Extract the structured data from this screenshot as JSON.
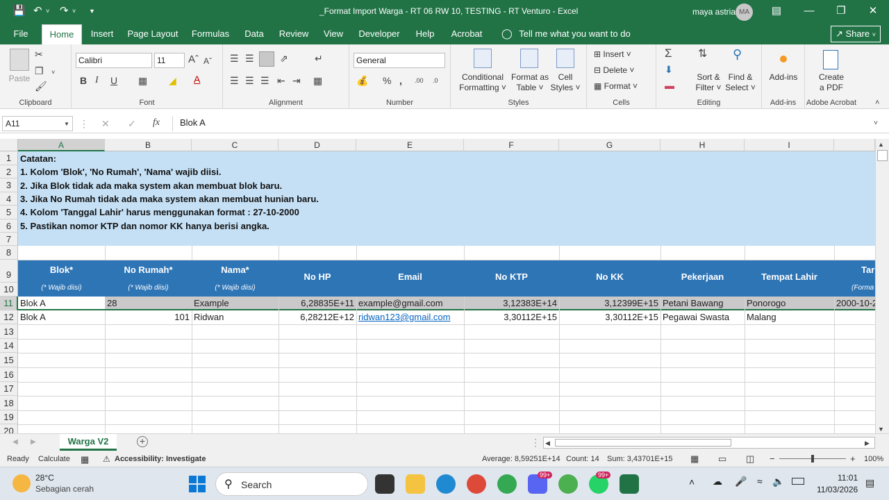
{
  "window": {
    "title": "_Format Import Warga - RT 06 RW 10, TESTING - RT Venturo  -  Excel",
    "user_name": "maya astria",
    "user_initials": "MA"
  },
  "ribbon_tabs": [
    "File",
    "Home",
    "Insert",
    "Page Layout",
    "Formulas",
    "Data",
    "Review",
    "View",
    "Developer",
    "Help",
    "Acrobat"
  ],
  "tell_me": "Tell me what you want to do",
  "share": "Share",
  "ribbon": {
    "clipboard": {
      "label": "Clipboard",
      "paste": "Paste"
    },
    "font": {
      "label": "Font",
      "name": "Calibri",
      "size": "11"
    },
    "alignment": {
      "label": "Alignment"
    },
    "number": {
      "label": "Number",
      "format": "General"
    },
    "styles": {
      "label": "Styles",
      "conditional": [
        "Conditional",
        "Formatting ˅"
      ],
      "format_table": [
        "Format as",
        "Table ˅"
      ],
      "cell_styles": [
        "Cell",
        "Styles ˅"
      ]
    },
    "cells": {
      "label": "Cells",
      "insert": "Insert",
      "delete": "Delete",
      "format": "Format"
    },
    "editing": {
      "label": "Editing",
      "sort": [
        "Sort &",
        "Filter ˅"
      ],
      "find": [
        "Find &",
        "Select ˅"
      ]
    },
    "addins": {
      "label": "Add-ins",
      "button": "Add-ins"
    },
    "acrobat": {
      "label": "Adobe Acrobat",
      "button": [
        "Create",
        "a PDF"
      ]
    }
  },
  "formula_bar": {
    "name_box": "A11",
    "formula": "Blok A",
    "fx": "fx"
  },
  "columns": [
    "A",
    "B",
    "C",
    "D",
    "E",
    "F",
    "G",
    "H",
    "I"
  ],
  "rows": [
    "1",
    "2",
    "3",
    "4",
    "5",
    "6",
    "7",
    "8",
    "9",
    "10",
    "11",
    "12",
    "13",
    "14",
    "15",
    "16",
    "17",
    "18",
    "19",
    "20"
  ],
  "notes": [
    "Catatan:",
    "1. Kolom 'Blok', 'No Rumah', 'Nama' wajib diisi.",
    "2. Jika Blok tidak ada maka system akan membuat blok baru.",
    "3. Jika No Rumah tidak ada maka system akan membuat hunian baru.",
    "4. Kolom 'Tanggal Lahir' harus menggunakan format : 27-10-2000",
    "5. Pastikan nomor KTP dan nomor KK hanya berisi angka."
  ],
  "table_headers": [
    "Blok*",
    "No Rumah*",
    "Nama*",
    "No HP",
    "Email",
    "No KTP",
    "No KK",
    "Pekerjaan",
    "Tempat Lahir",
    "Tar"
  ],
  "table_subheaders": [
    "(* Wajib diisi)",
    "(* Wajib diisi)",
    "(* Wajib diisi)",
    "(Forma"
  ],
  "data_rows": [
    [
      "Blok A",
      "28",
      "Example",
      "6,28835E+11",
      "example@gmail.com",
      "3,12383E+14",
      "3,12399E+15",
      "Petani Bawang",
      "Ponorogo",
      "2000-10-2"
    ],
    [
      "Blok A",
      "101",
      "Ridwan",
      "6,28212E+12",
      "ridwan123@gmail.com",
      "3,30112E+15",
      "3,30112E+15",
      "Pegawai Swasta",
      "Malang",
      ""
    ]
  ],
  "sheet_tab": "Warga V2",
  "status": {
    "ready": "Ready",
    "calculate": "Calculate",
    "accessibility": "Accessibility: Investigate",
    "average": "Average: 8,59251E+14",
    "count": "Count: 14",
    "sum": "Sum: 3,43701E+15",
    "zoom": "100%"
  },
  "taskbar": {
    "weather_temp": "28°C",
    "weather_desc": "Sebagian cerah",
    "search": "Search",
    "time": "11:01",
    "date": "11/03/2026",
    "badge1": "99+",
    "badge2": "99+"
  },
  "colors": {
    "excel_green": "#217346",
    "header_blue": "#2e75b6",
    "note_fill": "#c5e0f5",
    "selected_row": "#c9c9c9"
  }
}
